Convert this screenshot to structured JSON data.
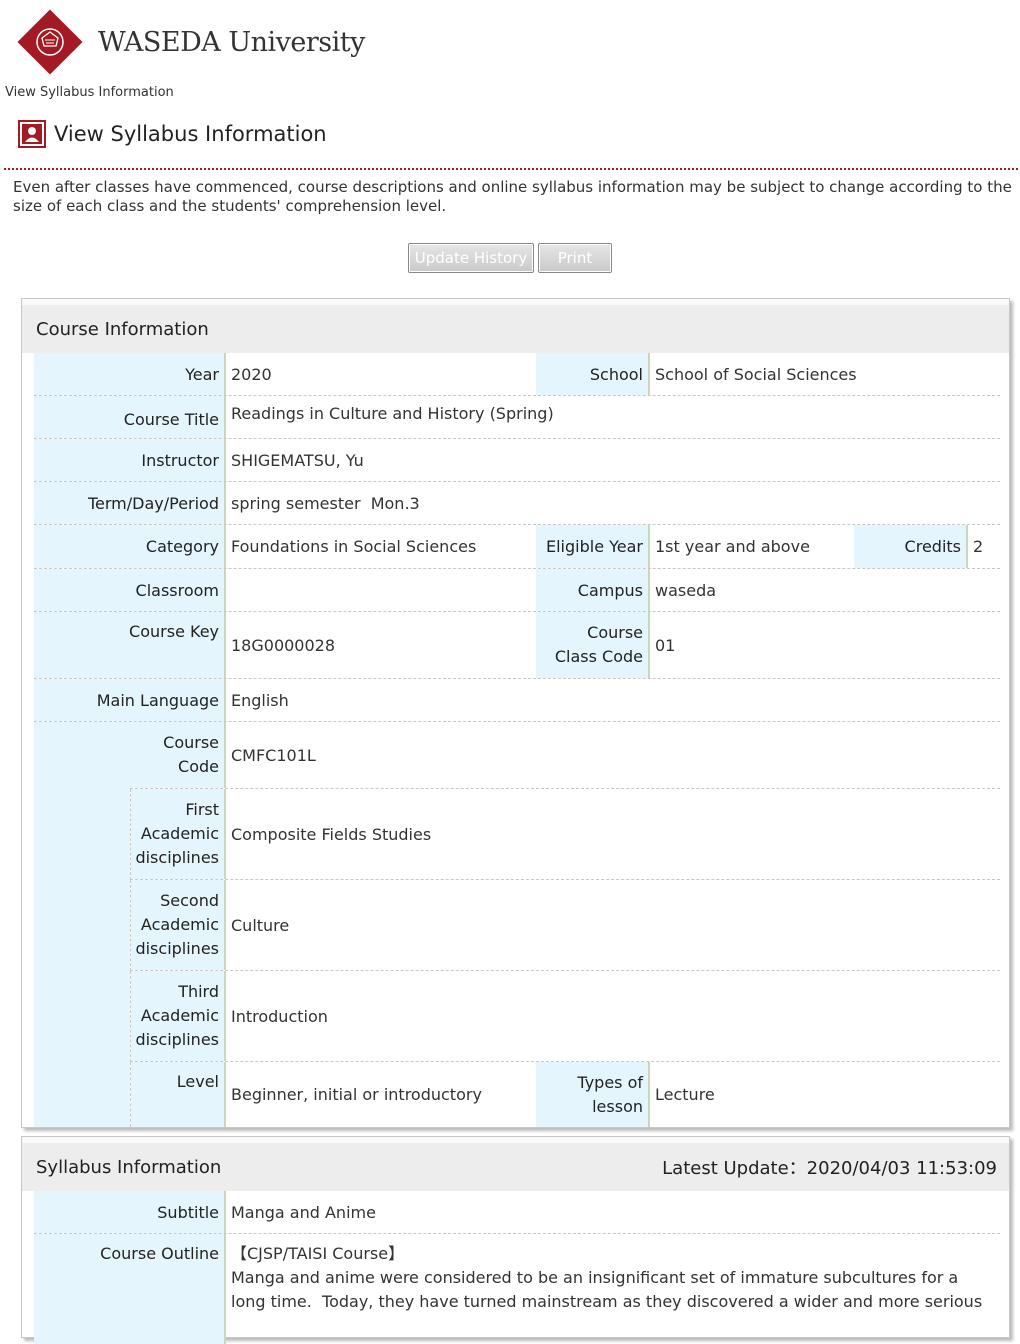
{
  "brand": {
    "name": "WASEDA University"
  },
  "breadcrumb": "View Syllabus Information",
  "page": {
    "title": "View Syllabus Information"
  },
  "notice": "Even after classes have commenced, course descriptions and online syllabus information may be subject to change according to the size of each class and the students' comprehension level.",
  "buttons": {
    "update_history": "Update History",
    "print": "Print"
  },
  "course": {
    "heading": "Course Information",
    "labels": {
      "year": "Year",
      "school": "School",
      "course_title": "Course Title",
      "instructor": "Instructor",
      "term": "Term/Day/Period",
      "category": "Category",
      "eligible_year": "Eligible Year",
      "credits": "Credits",
      "classroom": "Classroom",
      "campus": "Campus",
      "course_key": "Course Key",
      "course_class_code": "Course Class Code",
      "main_language": "Main Language",
      "course_code": "Course Code",
      "first_disc": "First Academic disciplines",
      "second_disc": "Second Academic disciplines",
      "third_disc": "Third Academic disciplines",
      "level": "Level",
      "types_of_lesson": "Types of lesson"
    },
    "values": {
      "year": "2020",
      "school": "School of Social Sciences",
      "course_title": "Readings in Culture and History (Spring)",
      "instructor": "SHIGEMATSU, Yu",
      "term": "spring semester  Mon.3",
      "category": "Foundations in Social Sciences",
      "eligible_year": "1st year and above",
      "credits": "2",
      "classroom": "",
      "campus": "waseda",
      "course_key": "18G0000028",
      "course_class_code": "01",
      "main_language": "English",
      "course_code": "CMFC101L",
      "first_disc": "Composite Fields Studies",
      "second_disc": "Culture",
      "third_disc": "Introduction",
      "level": "Beginner, initial or introductory",
      "types_of_lesson": "Lecture"
    }
  },
  "syllabus": {
    "heading": "Syllabus Information",
    "latest_update": "Latest Update：2020/04/03 11:53:09",
    "labels": {
      "subtitle": "Subtitle",
      "course_outline": "Course Outline"
    },
    "values": {
      "subtitle": "Manga and Anime",
      "outline_tag": "【CJSP/TAISI Course】",
      "outline_text": "Manga and anime were considered to be an insignificant set of immature subcultures for a long time.  Today, they have turned mainstream as they discovered a wider and more serious"
    }
  },
  "colors": {
    "brand_red": "#a31a24",
    "label_bg": "#e5f5fe",
    "header_bg": "#ededed"
  },
  "icons": [
    "waseda-logo-icon",
    "syllabus-page-icon"
  ]
}
